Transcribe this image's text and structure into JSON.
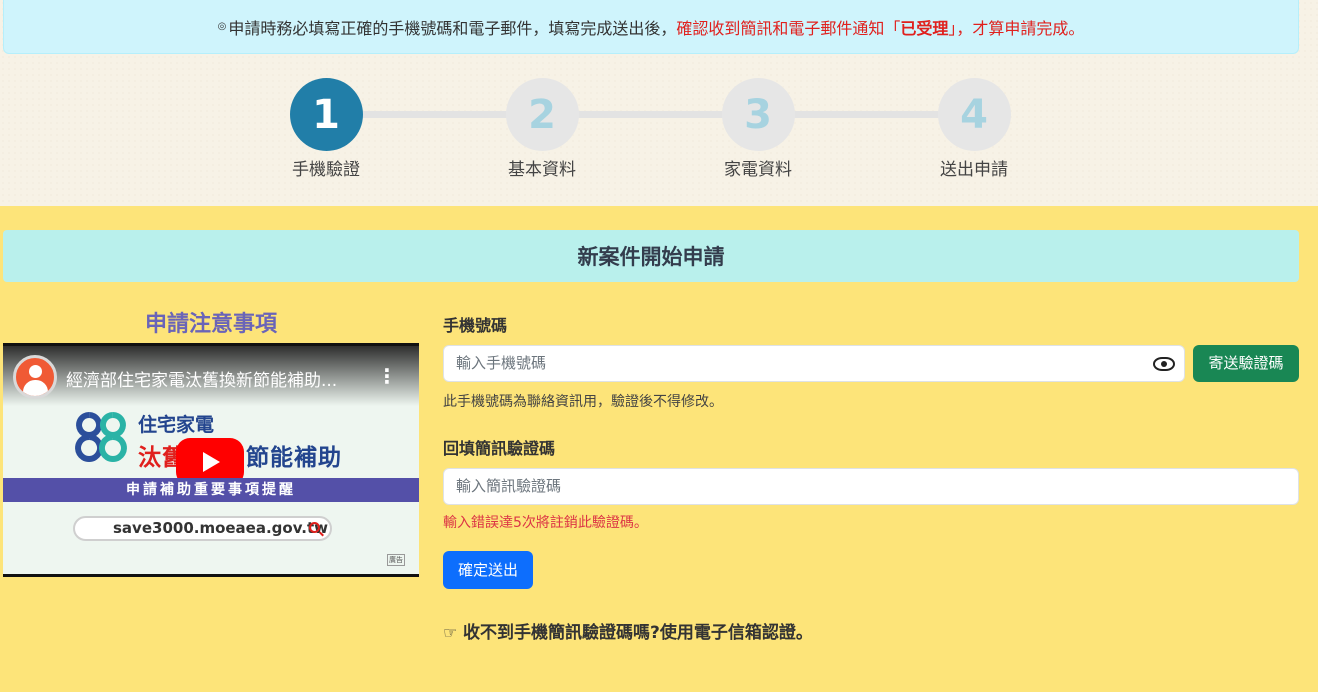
{
  "notice": {
    "bullet": "◎",
    "part1": "申請時務必填寫正確的手機號碼和電子郵件，填寫完成送出後，",
    "part2": "確認收到簡訊和電子郵件通知「",
    "part3": "已受理",
    "part4": "」，才算申請完成。"
  },
  "steps": [
    {
      "number": "1",
      "label": "手機驗證"
    },
    {
      "number": "2",
      "label": "基本資料"
    },
    {
      "number": "3",
      "label": "家電資料"
    },
    {
      "number": "4",
      "label": "送出申請"
    }
  ],
  "section_title": "新案件開始申請",
  "notes": {
    "title": "申請注意事項",
    "video": {
      "title": "經濟部住宅家電汰舊換新節能補助...",
      "brand_line1": "住宅家電",
      "brand_line2_red": "汰舊",
      "brand_line2_rest": "節能補助",
      "banner": "申請補助重要事項提醒",
      "url": "save3000.moeaea.gov.tw",
      "tag": "廣告",
      "kebab": "⋮"
    }
  },
  "form": {
    "phone_label": "手機號碼",
    "phone_placeholder": "輸入手機號碼",
    "send_code_button": "寄送驗證碼",
    "phone_hint": "此手機號碼為聯絡資訊用，驗證後不得修改。",
    "code_label": "回填簡訊驗證碼",
    "code_placeholder": "輸入簡訊驗證碼",
    "code_hint": "輸入錯誤達5次將註銷此驗證碼。",
    "submit_button": "確定送出",
    "email_link": "收不到手機簡訊驗證碼嗎?使用電子信箱認證。"
  },
  "colors": {
    "background": "#fde479",
    "step_active": "#217ea8",
    "send_button": "#198754",
    "submit_button": "#0d6efd",
    "alert_red": "#e0201d"
  }
}
